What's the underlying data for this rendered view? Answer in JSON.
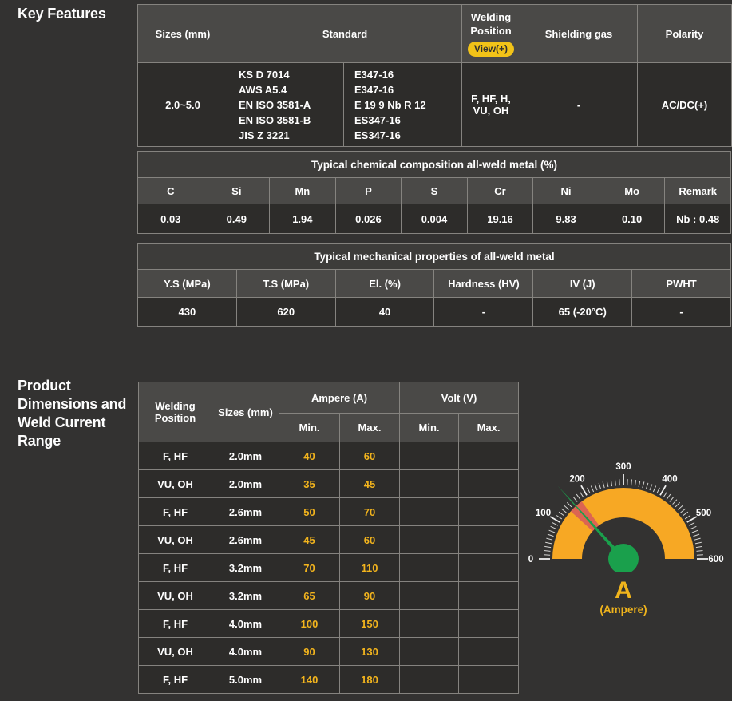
{
  "key_features": {
    "title": "Key Features"
  },
  "spec_table": {
    "headers": {
      "sizes": "Sizes (mm)",
      "standard": "Standard",
      "welding_position": "Welding Position",
      "view_badge": "View(+)",
      "shielding_gas": "Shielding gas",
      "polarity": "Polarity"
    },
    "row": {
      "sizes": "2.0~5.0",
      "standard_col1": [
        "KS D 7014",
        "AWS A5.4",
        "EN ISO 3581-A",
        "EN ISO 3581-B",
        "JIS Z 3221"
      ],
      "standard_col2": [
        "E347-16",
        "E347-16",
        "E 19 9 Nb R 12",
        "ES347-16",
        "ES347-16"
      ],
      "welding_position": "F, HF, H, VU, OH",
      "shielding_gas": "-",
      "polarity": "AC/DC(+)"
    }
  },
  "chemical_table": {
    "title": "Typical chemical composition all-weld metal (%)",
    "headers": [
      "C",
      "Si",
      "Mn",
      "P",
      "S",
      "Cr",
      "Ni",
      "Mo",
      "Remark"
    ],
    "values": [
      "0.03",
      "0.49",
      "1.94",
      "0.026",
      "0.004",
      "19.16",
      "9.83",
      "0.10",
      "Nb : 0.48"
    ]
  },
  "mechanical_table": {
    "title": "Typical mechanical properties of all-weld metal",
    "headers": [
      "Y.S (MPa)",
      "T.S (MPa)",
      "El. (%)",
      "Hardness (HV)",
      "IV (J)",
      "PWHT"
    ],
    "values": [
      "430",
      "620",
      "40",
      "-",
      "65 (-20°C)",
      "-"
    ]
  },
  "product_section": {
    "title": "Product Dimensions and Weld Current Range"
  },
  "product_table": {
    "headers": {
      "welding_position": "Welding Position",
      "sizes": "Sizes (mm)",
      "ampere": "Ampere (A)",
      "volt": "Volt (V)",
      "min": "Min.",
      "max": "Max."
    },
    "rows": [
      {
        "position": "F, HF",
        "size": "2.0mm",
        "amp_min": "40",
        "amp_max": "60",
        "volt_min": "",
        "volt_max": ""
      },
      {
        "position": "VU, OH",
        "size": "2.0mm",
        "amp_min": "35",
        "amp_max": "45",
        "volt_min": "",
        "volt_max": ""
      },
      {
        "position": "F, HF",
        "size": "2.6mm",
        "amp_min": "50",
        "amp_max": "70",
        "volt_min": "",
        "volt_max": ""
      },
      {
        "position": "VU, OH",
        "size": "2.6mm",
        "amp_min": "45",
        "amp_max": "60",
        "volt_min": "",
        "volt_max": ""
      },
      {
        "position": "F, HF",
        "size": "3.2mm",
        "amp_min": "70",
        "amp_max": "110",
        "volt_min": "",
        "volt_max": ""
      },
      {
        "position": "VU, OH",
        "size": "3.2mm",
        "amp_min": "65",
        "amp_max": "90",
        "volt_min": "",
        "volt_max": ""
      },
      {
        "position": "F, HF",
        "size": "4.0mm",
        "amp_min": "100",
        "amp_max": "150",
        "volt_min": "",
        "volt_max": ""
      },
      {
        "position": "VU, OH",
        "size": "4.0mm",
        "amp_min": "90",
        "amp_max": "130",
        "volt_min": "",
        "volt_max": ""
      },
      {
        "position": "F, HF",
        "size": "5.0mm",
        "amp_min": "140",
        "amp_max": "180",
        "volt_min": "",
        "volt_max": ""
      }
    ]
  },
  "chart_data": {
    "type": "gauge",
    "title": "A",
    "subtitle": "(Ampere)",
    "min": 0,
    "max": 600,
    "major_tick": 100,
    "minor_tick": 10,
    "tick_labels": [
      "0",
      "100",
      "200",
      "300",
      "400",
      "500",
      "600"
    ],
    "needle_value": 160,
    "highlight_band": {
      "from": 140,
      "to": 180
    }
  },
  "colors": {
    "page-bg": "#333231",
    "header-bg": "#4a4947",
    "title-bg": "#3d3c3a",
    "cell-bg": "#2d2c2a",
    "border": "#85837f",
    "text": "#ffffff",
    "accent-yellow": "#f2b41d",
    "badge-bg": "#f2c318",
    "badge-text": "#32312f",
    "gauge-orange": "#f7a824",
    "gauge-red": "#d95f57",
    "gauge-green": "#1aa04c",
    "gauge-gold": "#f0b41c"
  }
}
